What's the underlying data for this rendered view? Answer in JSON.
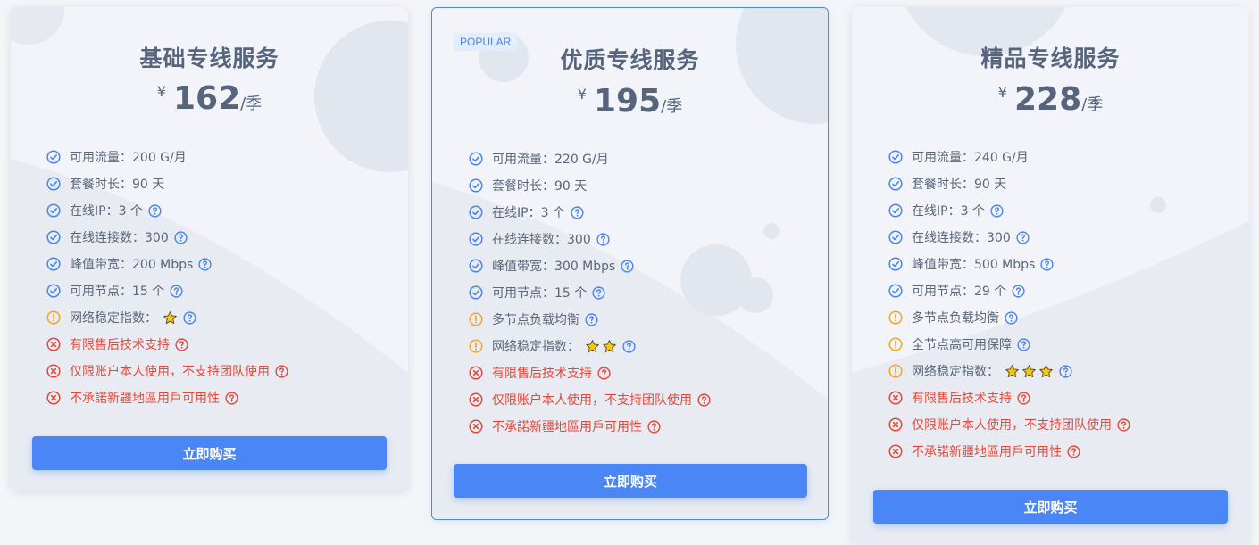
{
  "plans": [
    {
      "title": "基础专线服务",
      "currency": "¥",
      "price": "162",
      "period": "/季",
      "features": [
        {
          "text": "可用流量：200 G/月",
          "status": "ok",
          "help": false
        },
        {
          "text": "套餐时长：90 天",
          "status": "ok",
          "help": false
        },
        {
          "text": "在线IP：3 个",
          "status": "ok",
          "help": true
        },
        {
          "text": "在线连接数：300",
          "status": "ok",
          "help": true
        },
        {
          "text": "峰值带宽：200 Mbps",
          "status": "ok",
          "help": true
        },
        {
          "text": "可用节点：15 个",
          "status": "ok",
          "help": true
        },
        {
          "text": "网络稳定指数：",
          "status": "warn",
          "help": true,
          "stars": 1
        },
        {
          "text": "有限售后技术支持",
          "status": "no",
          "help": true
        },
        {
          "text": "仅限账户本人使用，不支持团队使用",
          "status": "no",
          "help": true
        },
        {
          "text": "不承諾新疆地區用戶可用性",
          "status": "no",
          "help": true
        }
      ],
      "button": "立即购买"
    },
    {
      "title": "优质专线服务",
      "badge": "POPULAR",
      "currency": "¥",
      "price": "195",
      "period": "/季",
      "features": [
        {
          "text": "可用流量：220 G/月",
          "status": "ok",
          "help": false
        },
        {
          "text": "套餐时长：90 天",
          "status": "ok",
          "help": false
        },
        {
          "text": "在线IP：3 个",
          "status": "ok",
          "help": true
        },
        {
          "text": "在线连接数：300",
          "status": "ok",
          "help": true
        },
        {
          "text": "峰值带宽：300 Mbps",
          "status": "ok",
          "help": true
        },
        {
          "text": "可用节点：15 个",
          "status": "ok",
          "help": true
        },
        {
          "text": "多节点负载均衡",
          "status": "warn",
          "help": true
        },
        {
          "text": "网络稳定指数：",
          "status": "warn",
          "help": true,
          "stars": 2
        },
        {
          "text": "有限售后技术支持",
          "status": "no",
          "help": true
        },
        {
          "text": "仅限账户本人使用，不支持团队使用",
          "status": "no",
          "help": true
        },
        {
          "text": "不承諾新疆地區用戶可用性",
          "status": "no",
          "help": true
        }
      ],
      "button": "立即购买"
    },
    {
      "title": "精品专线服务",
      "currency": "¥",
      "price": "228",
      "period": "/季",
      "features": [
        {
          "text": "可用流量：240 G/月",
          "status": "ok",
          "help": false
        },
        {
          "text": "套餐时长：90 天",
          "status": "ok",
          "help": false
        },
        {
          "text": "在线IP：3 个",
          "status": "ok",
          "help": true
        },
        {
          "text": "在线连接数：300",
          "status": "ok",
          "help": true
        },
        {
          "text": "峰值带宽：500 Mbps",
          "status": "ok",
          "help": true
        },
        {
          "text": "可用节点：29 个",
          "status": "ok",
          "help": true
        },
        {
          "text": "多节点负载均衡",
          "status": "warn",
          "help": true
        },
        {
          "text": "全节点高可用保障",
          "status": "warn",
          "help": true
        },
        {
          "text": "网络稳定指数：",
          "status": "warn",
          "help": true,
          "stars": 3
        },
        {
          "text": "有限售后技术支持",
          "status": "no",
          "help": true
        },
        {
          "text": "仅限账户本人使用，不支持团队使用",
          "status": "no",
          "help": true
        },
        {
          "text": "不承諾新疆地區用戶可用性",
          "status": "no",
          "help": true
        }
      ],
      "button": "立即购买"
    }
  ],
  "colors": {
    "ok": "#4a86e8",
    "warn": "#f5a623",
    "no": "#e04a3a",
    "help": "#4a86e8",
    "star": "#f5c518",
    "button": "#4a86f5"
  },
  "icons": {
    "ok": "check-circle-icon",
    "warn": "exclamation-circle-icon",
    "no": "x-circle-icon",
    "help": "question-circle-icon",
    "star": "star-icon"
  }
}
